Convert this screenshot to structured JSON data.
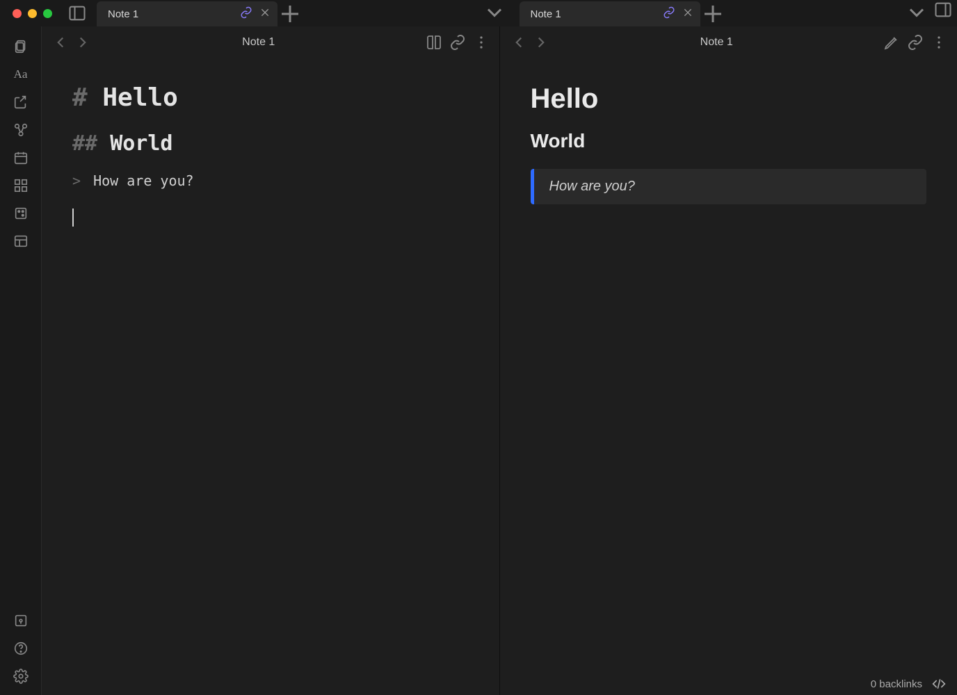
{
  "tabs": {
    "left": {
      "title": "Note 1"
    },
    "right": {
      "title": "Note 1"
    }
  },
  "panes": {
    "left": {
      "title": "Note 1",
      "content": {
        "h1_mark": "#",
        "h1_text": "Hello",
        "h2_mark": "##",
        "h2_text": "World",
        "quote_mark": ">",
        "quote_text": "How are you?"
      }
    },
    "right": {
      "title": "Note 1",
      "content": {
        "h1": "Hello",
        "h2": "World",
        "quote": "How are you?"
      }
    }
  },
  "status": {
    "backlinks": "0 backlinks"
  }
}
